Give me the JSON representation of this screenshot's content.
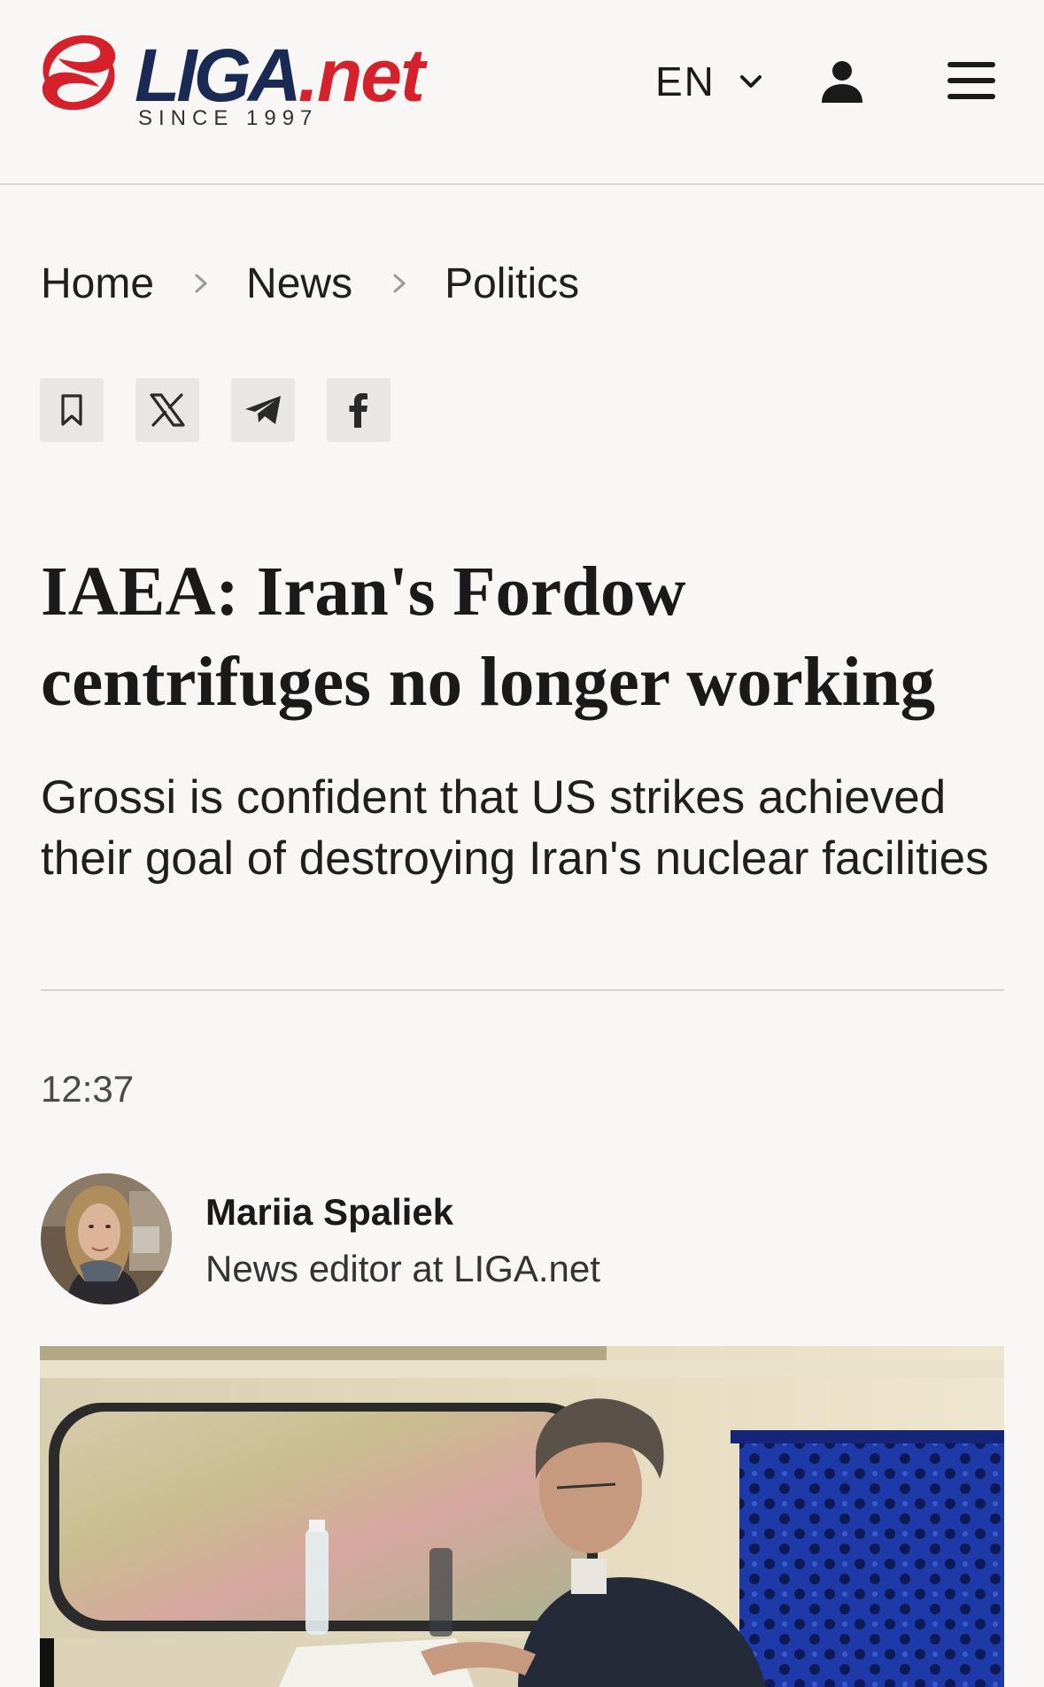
{
  "header": {
    "logo_name": "LIGA",
    "logo_tld": ".net",
    "logo_tagline": "SINCE 1997",
    "language": "EN",
    "icons": {
      "logo_mark": "liga-swirl-icon",
      "language_toggle": "chevron-down-icon",
      "account": "user-icon",
      "menu": "hamburger-menu-icon"
    },
    "colors": {
      "brand_navy": "#1b2a55",
      "brand_red": "#d5212b"
    }
  },
  "breadcrumb": {
    "items": [
      "Home",
      "News",
      "Politics"
    ],
    "separator_icon": "chevron-right-icon"
  },
  "share": {
    "buttons": [
      {
        "icon": "bookmark-icon"
      },
      {
        "icon": "x-twitter-icon"
      },
      {
        "icon": "telegram-icon"
      },
      {
        "icon": "facebook-icon"
      }
    ]
  },
  "article": {
    "headline": "IAEA: Iran's Fordow centrifuges no longer working",
    "subtitle": "Grossi is confident that US strikes achieved their goal of destroying Iran's nuclear facilities",
    "time": "12:37",
    "author": {
      "name": "Mariia Spaliek",
      "role": "News editor at LIGA.net"
    }
  }
}
